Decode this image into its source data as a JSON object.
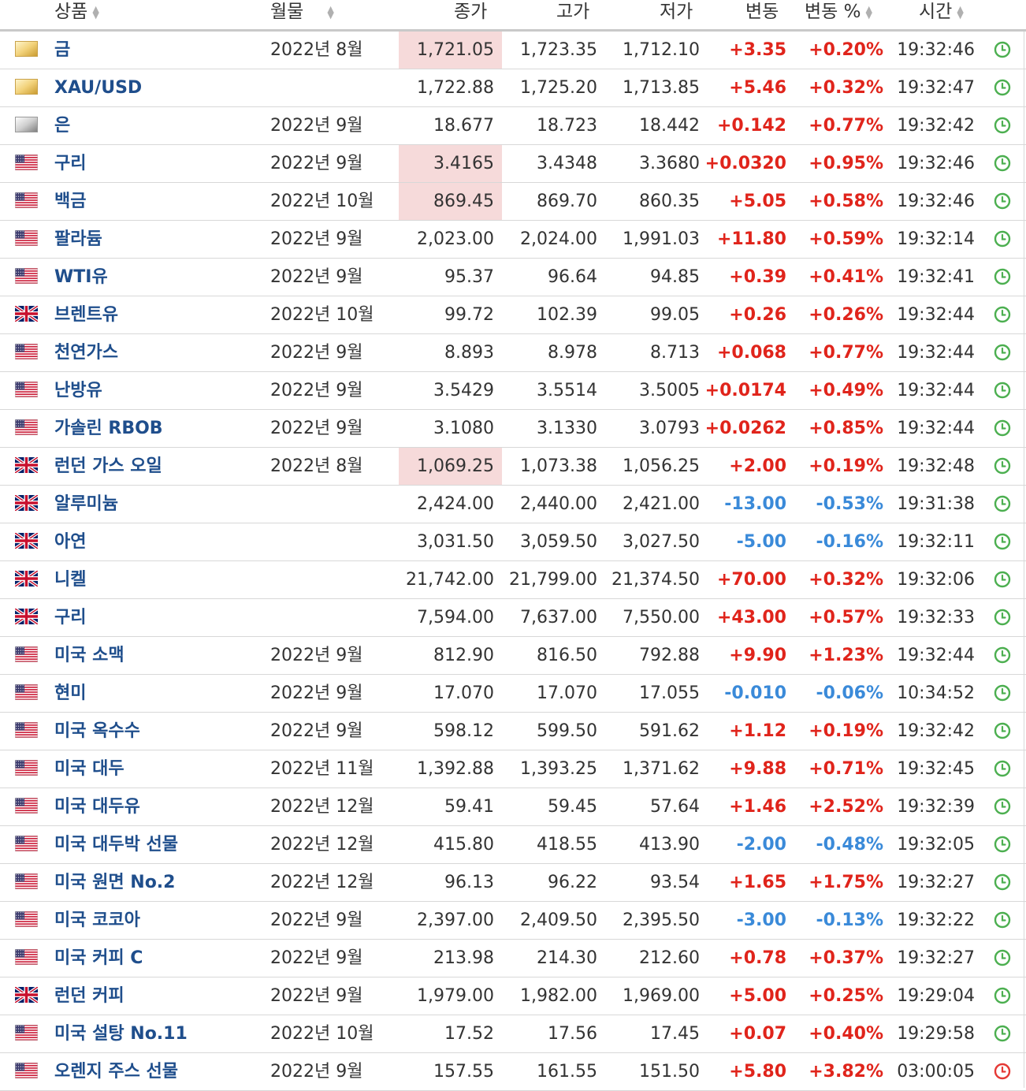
{
  "headers": {
    "name": "상품",
    "month": "월물",
    "close": "종가",
    "high": "고가",
    "low": "저가",
    "change": "변동",
    "change_pct": "변동 %",
    "time": "시간"
  },
  "colors": {
    "positive": "#e0241b",
    "negative": "#3a8ad9",
    "name": "#1f4e8c",
    "highlight": "#f6dada",
    "clock_green": "#4caf50",
    "clock_red": "#e53935"
  },
  "rows": [
    {
      "flag": "gold",
      "name": "금",
      "month": "2022년 8월",
      "close": "1,721.05",
      "high": "1,723.35",
      "low": "1,712.10",
      "change": "+3.35",
      "pct": "+0.20%",
      "time": "19:32:46",
      "dir": "pos",
      "hl": true,
      "clock": "green-clock-icon"
    },
    {
      "flag": "gold",
      "name": "XAU/USD",
      "month": "",
      "close": "1,722.88",
      "high": "1,725.20",
      "low": "1,713.85",
      "change": "+5.46",
      "pct": "+0.32%",
      "time": "19:32:47",
      "dir": "pos",
      "hl": false,
      "clock": "green-clock-icon"
    },
    {
      "flag": "silver",
      "name": "은",
      "month": "2022년 9월",
      "close": "18.677",
      "high": "18.723",
      "low": "18.442",
      "change": "+0.142",
      "pct": "+0.77%",
      "time": "19:32:42",
      "dir": "pos",
      "hl": false,
      "clock": "green-clock-icon"
    },
    {
      "flag": "us",
      "name": "구리",
      "month": "2022년 9월",
      "close": "3.4165",
      "high": "3.4348",
      "low": "3.3680",
      "change": "+0.0320",
      "pct": "+0.95%",
      "time": "19:32:46",
      "dir": "pos",
      "hl": true,
      "clock": "green-clock-icon"
    },
    {
      "flag": "us",
      "name": "백금",
      "month": "2022년 10월",
      "close": "869.45",
      "high": "869.70",
      "low": "860.35",
      "change": "+5.05",
      "pct": "+0.58%",
      "time": "19:32:46",
      "dir": "pos",
      "hl": true,
      "clock": "green-clock-icon"
    },
    {
      "flag": "us",
      "name": "팔라듐",
      "month": "2022년 9월",
      "close": "2,023.00",
      "high": "2,024.00",
      "low": "1,991.03",
      "change": "+11.80",
      "pct": "+0.59%",
      "time": "19:32:14",
      "dir": "pos",
      "hl": false,
      "clock": "green-clock-icon"
    },
    {
      "flag": "us",
      "name": "WTI유",
      "month": "2022년 9월",
      "close": "95.37",
      "high": "96.64",
      "low": "94.85",
      "change": "+0.39",
      "pct": "+0.41%",
      "time": "19:32:41",
      "dir": "pos",
      "hl": false,
      "clock": "green-clock-icon"
    },
    {
      "flag": "uk",
      "name": "브렌트유",
      "month": "2022년 10월",
      "close": "99.72",
      "high": "102.39",
      "low": "99.05",
      "change": "+0.26",
      "pct": "+0.26%",
      "time": "19:32:44",
      "dir": "pos",
      "hl": false,
      "clock": "green-clock-icon"
    },
    {
      "flag": "us",
      "name": "천연가스",
      "month": "2022년 9월",
      "close": "8.893",
      "high": "8.978",
      "low": "8.713",
      "change": "+0.068",
      "pct": "+0.77%",
      "time": "19:32:44",
      "dir": "pos",
      "hl": false,
      "clock": "green-clock-icon"
    },
    {
      "flag": "us",
      "name": "난방유",
      "month": "2022년 9월",
      "close": "3.5429",
      "high": "3.5514",
      "low": "3.5005",
      "change": "+0.0174",
      "pct": "+0.49%",
      "time": "19:32:44",
      "dir": "pos",
      "hl": false,
      "clock": "green-clock-icon"
    },
    {
      "flag": "us",
      "name": "가솔린 RBOB",
      "month": "2022년 9월",
      "close": "3.1080",
      "high": "3.1330",
      "low": "3.0793",
      "change": "+0.0262",
      "pct": "+0.85%",
      "time": "19:32:44",
      "dir": "pos",
      "hl": false,
      "clock": "green-clock-icon"
    },
    {
      "flag": "uk",
      "name": "런던 가스 오일",
      "month": "2022년 8월",
      "close": "1,069.25",
      "high": "1,073.38",
      "low": "1,056.25",
      "change": "+2.00",
      "pct": "+0.19%",
      "time": "19:32:48",
      "dir": "pos",
      "hl": true,
      "clock": "green-clock-icon"
    },
    {
      "flag": "uk",
      "name": "알루미늄",
      "month": "",
      "close": "2,424.00",
      "high": "2,440.00",
      "low": "2,421.00",
      "change": "-13.00",
      "pct": "-0.53%",
      "time": "19:31:38",
      "dir": "neg",
      "hl": false,
      "clock": "green-clock-icon"
    },
    {
      "flag": "uk",
      "name": "아연",
      "month": "",
      "close": "3,031.50",
      "high": "3,059.50",
      "low": "3,027.50",
      "change": "-5.00",
      "pct": "-0.16%",
      "time": "19:32:11",
      "dir": "neg",
      "hl": false,
      "clock": "green-clock-icon"
    },
    {
      "flag": "uk",
      "name": "니켈",
      "month": "",
      "close": "21,742.00",
      "high": "21,799.00",
      "low": "21,374.50",
      "change": "+70.00",
      "pct": "+0.32%",
      "time": "19:32:06",
      "dir": "pos",
      "hl": false,
      "clock": "green-clock-icon"
    },
    {
      "flag": "uk",
      "name": "구리",
      "month": "",
      "close": "7,594.00",
      "high": "7,637.00",
      "low": "7,550.00",
      "change": "+43.00",
      "pct": "+0.57%",
      "time": "19:32:33",
      "dir": "pos",
      "hl": false,
      "clock": "green-clock-icon"
    },
    {
      "flag": "us",
      "name": "미국 소맥",
      "month": "2022년 9월",
      "close": "812.90",
      "high": "816.50",
      "low": "792.88",
      "change": "+9.90",
      "pct": "+1.23%",
      "time": "19:32:44",
      "dir": "pos",
      "hl": false,
      "clock": "green-clock-icon"
    },
    {
      "flag": "us",
      "name": "현미",
      "month": "2022년 9월",
      "close": "17.070",
      "high": "17.070",
      "low": "17.055",
      "change": "-0.010",
      "pct": "-0.06%",
      "time": "10:34:52",
      "dir": "neg",
      "hl": false,
      "clock": "green-clock-icon"
    },
    {
      "flag": "us",
      "name": "미국 옥수수",
      "month": "2022년 9월",
      "close": "598.12",
      "high": "599.50",
      "low": "591.62",
      "change": "+1.12",
      "pct": "+0.19%",
      "time": "19:32:42",
      "dir": "pos",
      "hl": false,
      "clock": "green-clock-icon"
    },
    {
      "flag": "us",
      "name": "미국 대두",
      "month": "2022년 11월",
      "close": "1,392.88",
      "high": "1,393.25",
      "low": "1,371.62",
      "change": "+9.88",
      "pct": "+0.71%",
      "time": "19:32:45",
      "dir": "pos",
      "hl": false,
      "clock": "green-clock-icon"
    },
    {
      "flag": "us",
      "name": "미국 대두유",
      "month": "2022년 12월",
      "close": "59.41",
      "high": "59.45",
      "low": "57.64",
      "change": "+1.46",
      "pct": "+2.52%",
      "time": "19:32:39",
      "dir": "pos",
      "hl": false,
      "clock": "green-clock-icon"
    },
    {
      "flag": "us",
      "name": "미국 대두박 선물",
      "month": "2022년 12월",
      "close": "415.80",
      "high": "418.55",
      "low": "413.90",
      "change": "-2.00",
      "pct": "-0.48%",
      "time": "19:32:05",
      "dir": "neg",
      "hl": false,
      "clock": "green-clock-icon"
    },
    {
      "flag": "us",
      "name": "미국 원면 No.2",
      "month": "2022년 12월",
      "close": "96.13",
      "high": "96.22",
      "low": "93.54",
      "change": "+1.65",
      "pct": "+1.75%",
      "time": "19:32:27",
      "dir": "pos",
      "hl": false,
      "clock": "green-clock-icon"
    },
    {
      "flag": "us",
      "name": "미국 코코아",
      "month": "2022년 9월",
      "close": "2,397.00",
      "high": "2,409.50",
      "low": "2,395.50",
      "change": "-3.00",
      "pct": "-0.13%",
      "time": "19:32:22",
      "dir": "neg",
      "hl": false,
      "clock": "green-clock-icon"
    },
    {
      "flag": "us",
      "name": "미국 커피 C",
      "month": "2022년 9월",
      "close": "213.98",
      "high": "214.30",
      "low": "212.60",
      "change": "+0.78",
      "pct": "+0.37%",
      "time": "19:32:27",
      "dir": "pos",
      "hl": false,
      "clock": "green-clock-icon"
    },
    {
      "flag": "uk",
      "name": "런던 커피",
      "month": "2022년 9월",
      "close": "1,979.00",
      "high": "1,982.00",
      "low": "1,969.00",
      "change": "+5.00",
      "pct": "+0.25%",
      "time": "19:29:04",
      "dir": "pos",
      "hl": false,
      "clock": "green-clock-icon"
    },
    {
      "flag": "us",
      "name": "미국 설탕 No.11",
      "month": "2022년 10월",
      "close": "17.52",
      "high": "17.56",
      "low": "17.45",
      "change": "+0.07",
      "pct": "+0.40%",
      "time": "19:29:58",
      "dir": "pos",
      "hl": false,
      "clock": "green-clock-icon"
    },
    {
      "flag": "us",
      "name": "오렌지 주스 선물",
      "month": "2022년 9월",
      "close": "157.55",
      "high": "161.55",
      "low": "151.50",
      "change": "+5.80",
      "pct": "+3.82%",
      "time": "03:00:05",
      "dir": "pos",
      "hl": false,
      "clock": "red-clock-icon"
    }
  ]
}
